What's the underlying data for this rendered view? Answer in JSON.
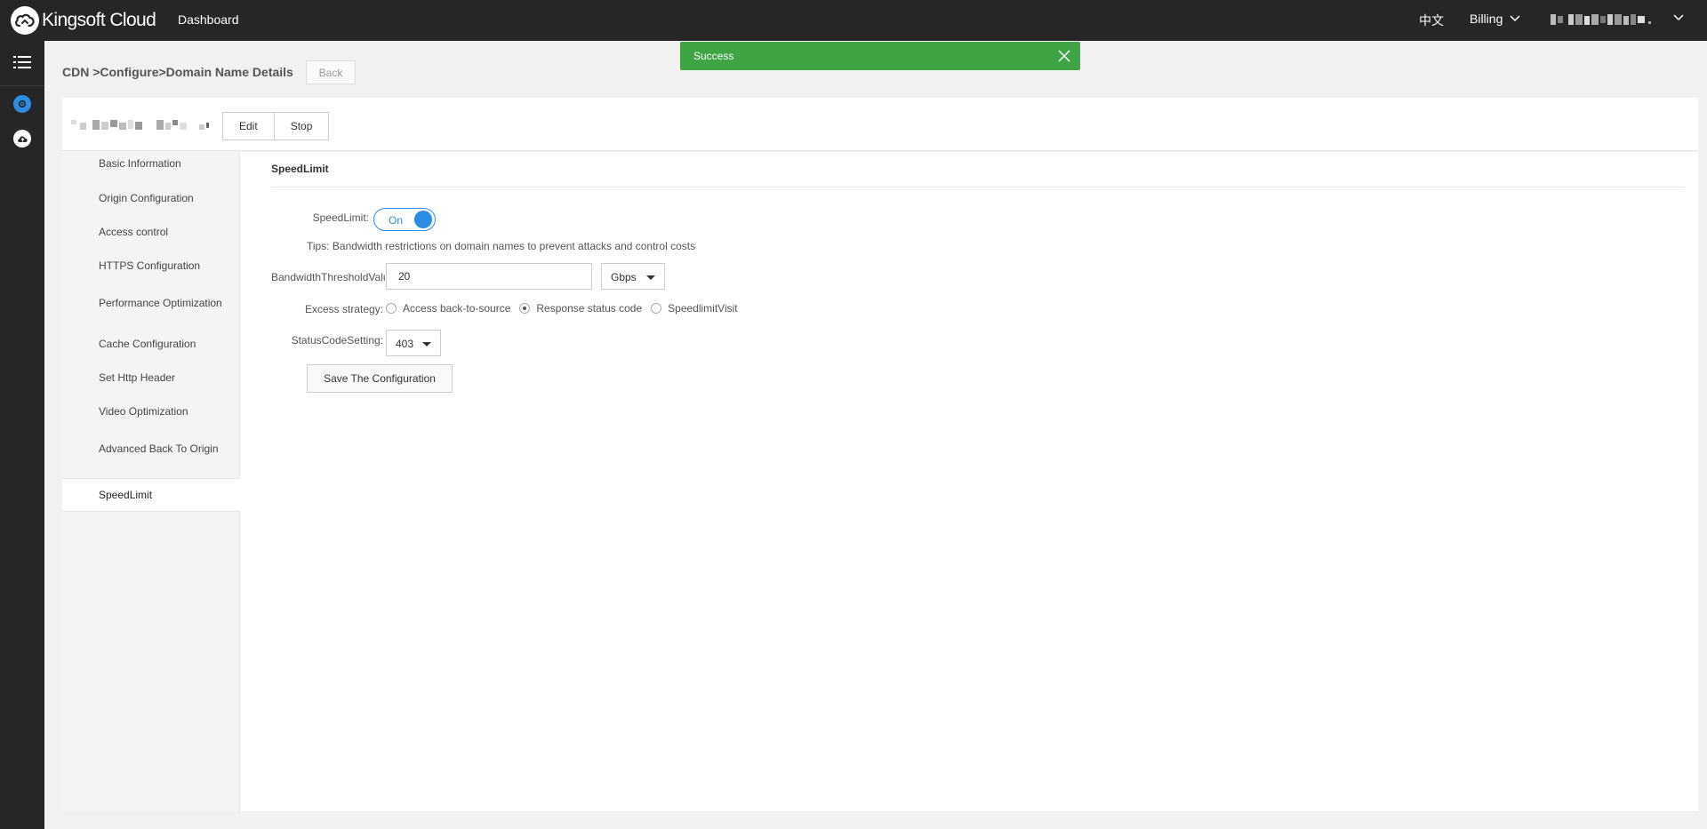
{
  "topbar": {
    "brand": "Kingsoft Cloud",
    "dashboard": "Dashboard",
    "language": "中文",
    "billing": "Billing"
  },
  "toast": {
    "message": "Success",
    "color": "#3ea444"
  },
  "header": {
    "breadcrumb": "CDN >Configure>Domain Name Details",
    "back": "Back"
  },
  "domain": {
    "edit": "Edit",
    "stop": "Stop"
  },
  "sidebar": {
    "items": [
      {
        "label": "Basic Information"
      },
      {
        "label": "Origin Configuration"
      },
      {
        "label": "Access control"
      },
      {
        "label": "HTTPS Configuration"
      },
      {
        "label": "Performance Optimization"
      },
      {
        "label": "Cache Configuration"
      },
      {
        "label": "Set Http Header"
      },
      {
        "label": "Video Optimization"
      },
      {
        "label": "Advanced Back To Origin"
      },
      {
        "label": "SpeedLimit"
      }
    ],
    "active": "SpeedLimit"
  },
  "form": {
    "section_title": "SpeedLimit",
    "speedlimit_label": "SpeedLimit:",
    "toggle_text": "On",
    "toggle_on": true,
    "tips": "Tips: Bandwidth restrictions on domain names to prevent attacks and control costs",
    "threshold_label": "BandwidthThresholdValu",
    "threshold_value": "20",
    "unit_selected": "Gbps",
    "excess_label": "Excess strategy:",
    "excess_options": [
      {
        "label": "Access back-to-source",
        "selected": false
      },
      {
        "label": "Response status code",
        "selected": true
      },
      {
        "label": "SpeedlimitVisit",
        "selected": false
      }
    ],
    "status_label": "StatusCodeSetting:",
    "status_selected": "403",
    "save": "Save The Configuration"
  },
  "colors": {
    "accent": "#2b8de3",
    "topbar": "#262626",
    "success": "#3ea444"
  }
}
